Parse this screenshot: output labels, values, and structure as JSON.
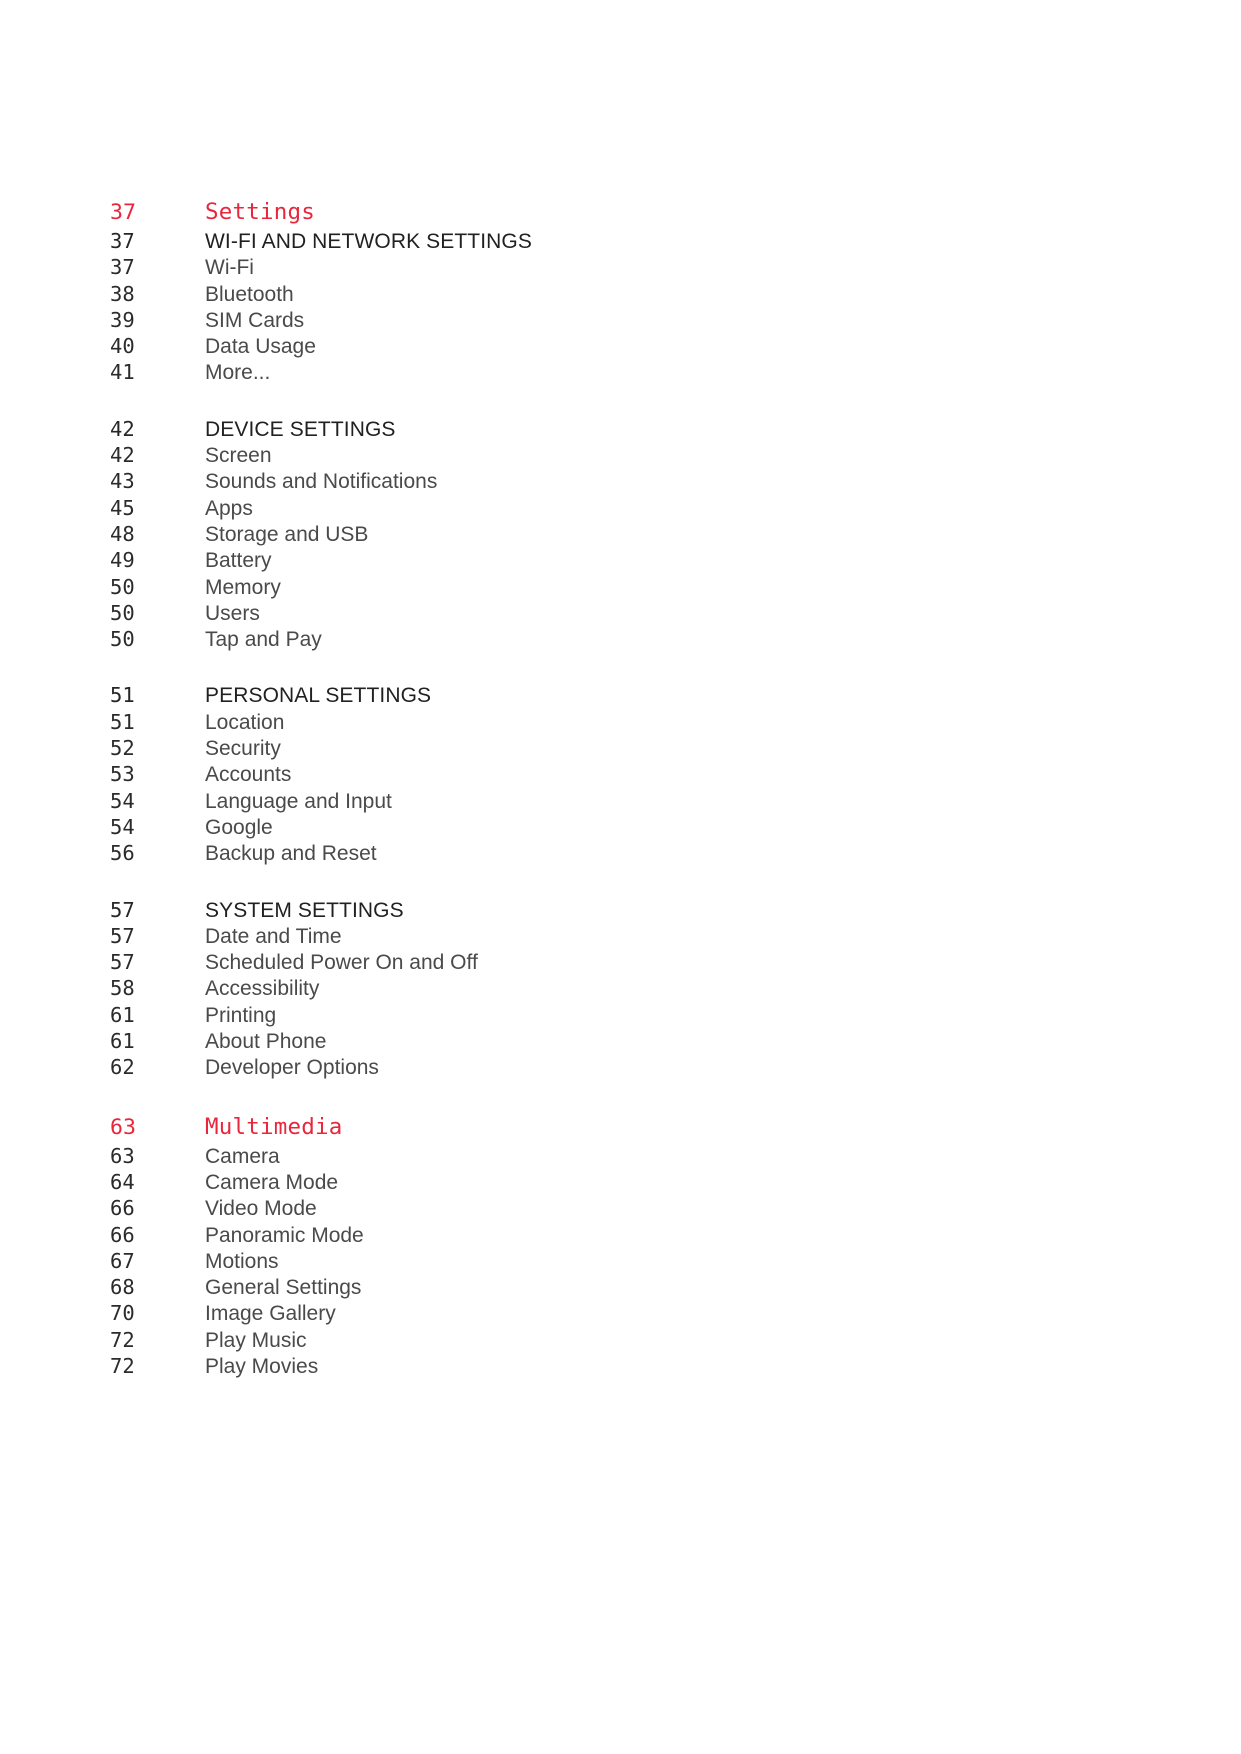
{
  "document": {
    "type": "table-of-contents",
    "accent_color": "#e8263c",
    "section_header_color": "#212121",
    "entry_color": "#4a4a4a",
    "background_color": "#ffffff"
  },
  "groups": [
    {
      "kind": "chapter",
      "page": "37",
      "label": "Settings",
      "entries": [
        {
          "kind": "section",
          "page": "37",
          "label": "WI-FI AND NETWORK SETTINGS"
        },
        {
          "kind": "entry",
          "page": "37",
          "label": "Wi-Fi"
        },
        {
          "kind": "entry",
          "page": "38",
          "label": "Bluetooth"
        },
        {
          "kind": "entry",
          "page": "39",
          "label": "SIM Cards"
        },
        {
          "kind": "entry",
          "page": "40",
          "label": "Data Usage"
        },
        {
          "kind": "entry",
          "page": "41",
          "label": "More..."
        }
      ]
    },
    {
      "kind": "group",
      "entries": [
        {
          "kind": "section",
          "page": "42",
          "label": "DEVICE SETTINGS"
        },
        {
          "kind": "entry",
          "page": "42",
          "label": "Screen"
        },
        {
          "kind": "entry",
          "page": "43",
          "label": "Sounds and Notifications"
        },
        {
          "kind": "entry",
          "page": "45",
          "label": "Apps"
        },
        {
          "kind": "entry",
          "page": "48",
          "label": "Storage and USB"
        },
        {
          "kind": "entry",
          "page": "49",
          "label": "Battery"
        },
        {
          "kind": "entry",
          "page": "50",
          "label": "Memory"
        },
        {
          "kind": "entry",
          "page": "50",
          "label": "Users"
        },
        {
          "kind": "entry",
          "page": "50",
          "label": "Tap and Pay"
        }
      ]
    },
    {
      "kind": "group",
      "entries": [
        {
          "kind": "section",
          "page": "51",
          "label": "PERSONAL SETTINGS"
        },
        {
          "kind": "entry",
          "page": "51",
          "label": "Location"
        },
        {
          "kind": "entry",
          "page": "52",
          "label": "Security"
        },
        {
          "kind": "entry",
          "page": "53",
          "label": "Accounts"
        },
        {
          "kind": "entry",
          "page": "54",
          "label": "Language and Input"
        },
        {
          "kind": "entry",
          "page": "54",
          "label": "Google"
        },
        {
          "kind": "entry",
          "page": "56",
          "label": "Backup and Reset"
        }
      ]
    },
    {
      "kind": "group",
      "entries": [
        {
          "kind": "section",
          "page": "57",
          "label": "SYSTEM SETTINGS"
        },
        {
          "kind": "entry",
          "page": "57",
          "label": "Date and Time"
        },
        {
          "kind": "entry",
          "page": "57",
          "label": "Scheduled Power On and Off"
        },
        {
          "kind": "entry",
          "page": "58",
          "label": "Accessibility"
        },
        {
          "kind": "entry",
          "page": "61",
          "label": "Printing"
        },
        {
          "kind": "entry",
          "page": "61",
          "label": "About Phone"
        },
        {
          "kind": "entry",
          "page": "62",
          "label": "Developer Options"
        }
      ]
    },
    {
      "kind": "chapter",
      "page": "63",
      "label": "Multimedia",
      "entries": [
        {
          "kind": "entry",
          "page": "63",
          "label": "Camera"
        },
        {
          "kind": "entry",
          "page": "64",
          "label": "Camera Mode"
        },
        {
          "kind": "entry",
          "page": "66",
          "label": "Video Mode"
        },
        {
          "kind": "entry",
          "page": "66",
          "label": "Panoramic Mode"
        },
        {
          "kind": "entry",
          "page": "67",
          "label": "Motions"
        },
        {
          "kind": "entry",
          "page": "68",
          "label": "General Settings"
        },
        {
          "kind": "entry",
          "page": "70",
          "label": "Image Gallery"
        },
        {
          "kind": "entry",
          "page": "72",
          "label": "Play Music"
        },
        {
          "kind": "entry",
          "page": "72",
          "label": "Play Movies"
        }
      ]
    }
  ]
}
